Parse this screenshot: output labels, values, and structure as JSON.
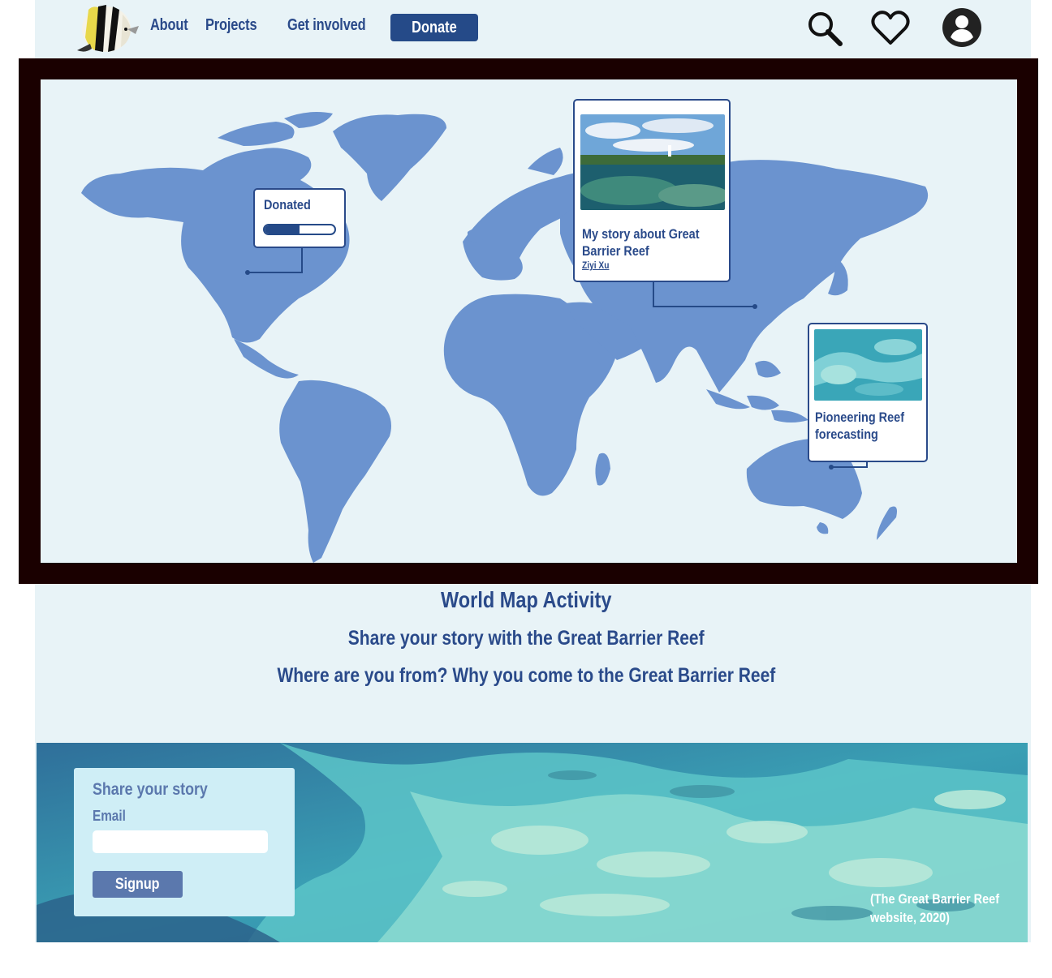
{
  "nav": {
    "about": "About",
    "projects": "Projects",
    "get_involved": "Get involved",
    "donate": "Donate",
    "icons": [
      "search-icon",
      "heart-icon",
      "account-icon"
    ]
  },
  "map": {
    "donated_popup": {
      "title": "Donated",
      "progress": 0.5
    },
    "story_popup": {
      "title": "My story about Great Barrier Reef",
      "author": "Ziyi Xu"
    },
    "forecast_popup": {
      "title": "Pioneering Reef forecasting"
    }
  },
  "headings": {
    "title": "World Map Activity",
    "subtitle": "Share your story with the Great Barrier Reef",
    "question": "Where are you from? Why you come to the Great Barrier Reef"
  },
  "signup": {
    "title": "Share your story",
    "email_label": "Email",
    "email_value": "",
    "button": "Signup"
  },
  "credit": "(The Great Barrier Reef website, 2020)",
  "colors": {
    "brand_navy": "#254a88",
    "heading_blue": "#2a4a8a",
    "land": "#6b93cf",
    "page_bg": "#e8f3f7",
    "frame": "#1a0000",
    "form_bg": "#cfeef6"
  }
}
